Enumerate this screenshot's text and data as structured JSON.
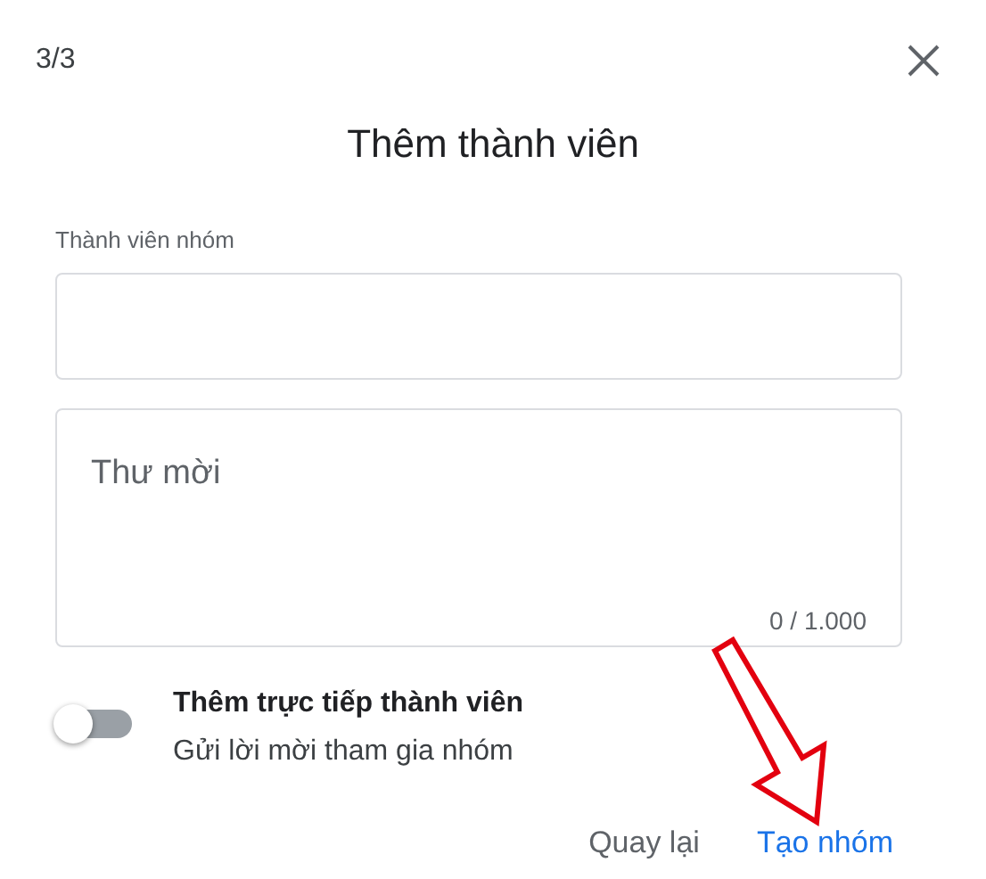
{
  "step": "3/3",
  "title": "Thêm thành viên",
  "members_field": {
    "label": "Thành viên nhóm"
  },
  "invitation_field": {
    "placeholder": "Thư mời",
    "counter": "0 / 1.000"
  },
  "toggle": {
    "on": false,
    "title": "Thêm trực tiếp thành viên",
    "subtitle": "Gửi lời mời tham gia nhóm"
  },
  "buttons": [
    {
      "label": "Quay lại",
      "kind": "secondary"
    },
    {
      "label": "Tạo nhóm",
      "kind": "primary"
    }
  ]
}
